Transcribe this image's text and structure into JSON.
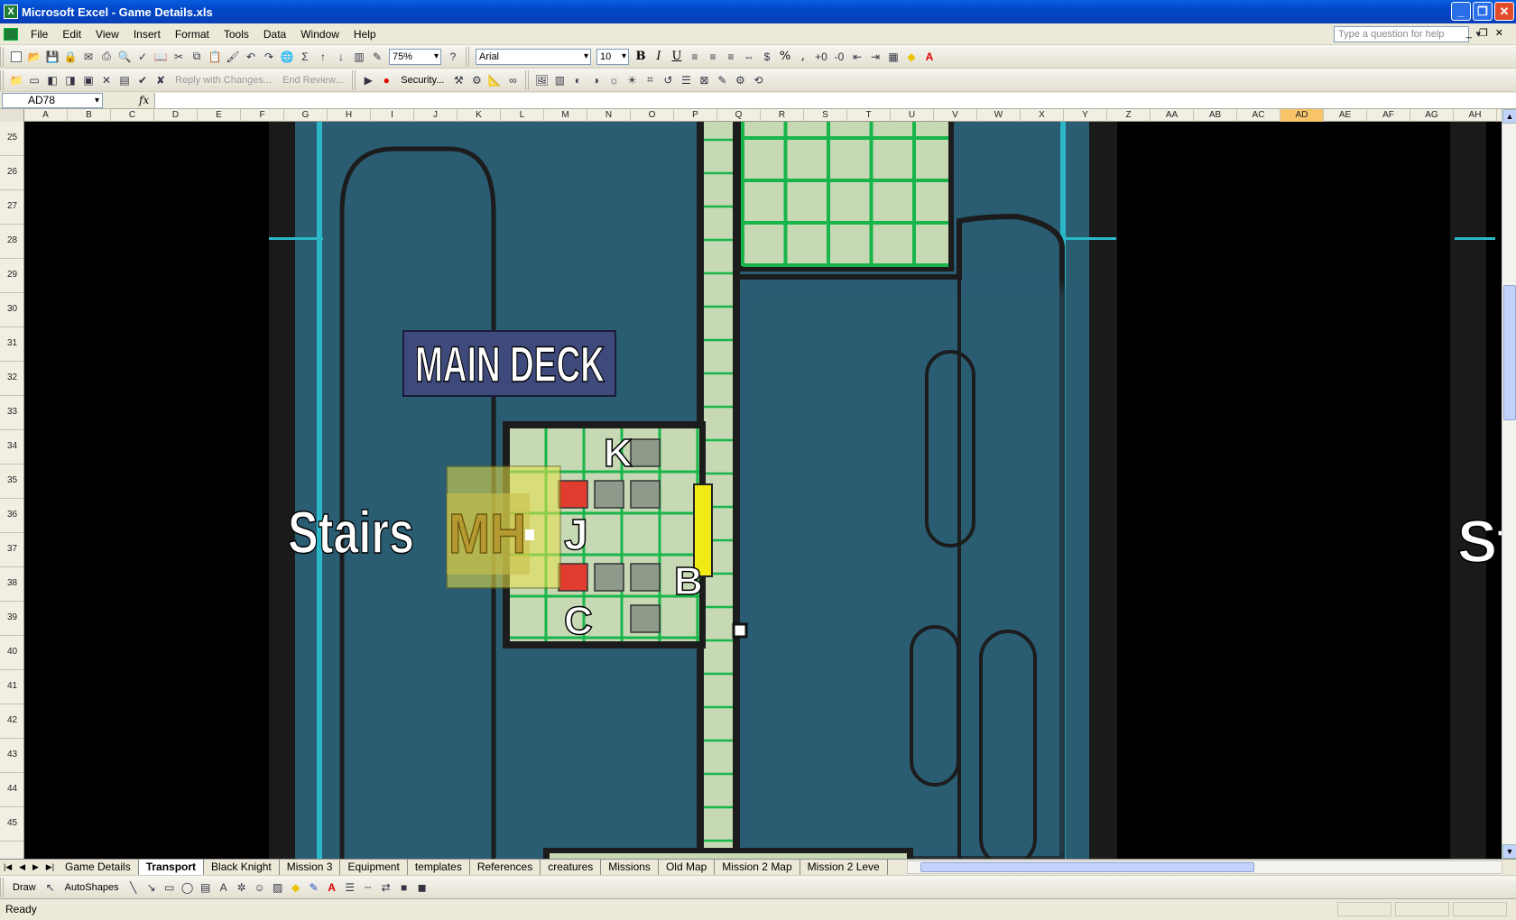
{
  "window": {
    "title": "Microsoft Excel - Game Details.xls",
    "app_badge": "X"
  },
  "menu": [
    "File",
    "Edit",
    "View",
    "Insert",
    "Format",
    "Tools",
    "Data",
    "Window",
    "Help"
  ],
  "help_box": {
    "placeholder": "Type a question for help"
  },
  "toolbar": {
    "zoom": "75%",
    "font": "Arial",
    "size": "10",
    "bold": "B",
    "italic": "I",
    "underline": "U",
    "percent": "%",
    "comma": ",",
    "reply_label": "Reply with Changes...",
    "end_review_label": "End Review...",
    "security_label": "Security..."
  },
  "formula_bar": {
    "name_box": "AD78",
    "fx": "fx",
    "value": ""
  },
  "columns": [
    "A",
    "B",
    "C",
    "D",
    "E",
    "F",
    "G",
    "H",
    "I",
    "J",
    "K",
    "L",
    "M",
    "N",
    "O",
    "P",
    "Q",
    "R",
    "S",
    "T",
    "U",
    "V",
    "W",
    "X",
    "Y",
    "Z",
    "AA",
    "AB",
    "AC",
    "AD",
    "AE",
    "AF",
    "AG",
    "AH"
  ],
  "active_column": "AD",
  "rows": [
    "25",
    "26",
    "27",
    "28",
    "29",
    "30",
    "31",
    "32",
    "33",
    "34",
    "35",
    "36",
    "37",
    "38",
    "39",
    "40",
    "41",
    "42",
    "43",
    "44",
    "45"
  ],
  "map": {
    "main_deck": "MAIN DECK",
    "stairs": "Stairs",
    "stairs_right": "St",
    "mh": "MH",
    "letter_k": "K",
    "letter_j": "J",
    "letter_b": "B",
    "letter_c": "C",
    "colors": {
      "deck": "#2a5c72",
      "floor": "#c6d8b4",
      "gridline": "#18b54a",
      "hull": "#1a1a1a",
      "label_bg": "#3f4a7c",
      "red_tile": "#e03c30",
      "yellow": "#f2ea14"
    }
  },
  "sheet_tabs": [
    "Game Details",
    "Transport",
    "Black Knight",
    "Mission 3",
    "Equipment",
    "templates",
    "References",
    "creatures",
    "Missions",
    "Old Map",
    "Mission 2 Map",
    "Mission 2 Leve"
  ],
  "active_tab": "Transport",
  "draw": {
    "draw_label": "Draw",
    "autoshapes_label": "AutoShapes"
  },
  "status": "Ready"
}
